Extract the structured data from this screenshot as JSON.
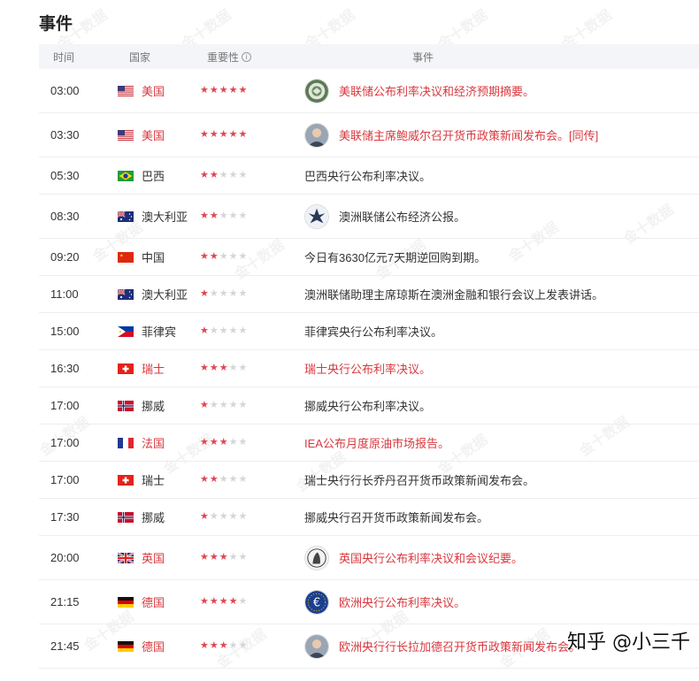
{
  "title": "事件",
  "headers": {
    "time": "时间",
    "country": "国家",
    "importance": "重要性",
    "event": "事件"
  },
  "colors": {
    "highlight": "#d9383e",
    "star_on": "#e04552",
    "star_off": "#d5d5d5"
  },
  "watermark": "金十数据",
  "credit": "知乎 @小三千",
  "events": [
    {
      "time": "03:00",
      "country": "美国",
      "flag": "us",
      "stars": 5,
      "event": "美联储公布利率决议和经济预期摘要。",
      "highlight": true,
      "avatar": "fed-seal-icon"
    },
    {
      "time": "03:30",
      "country": "美国",
      "flag": "us",
      "stars": 5,
      "event": "美联储主席鲍威尔召开货币政策新闻发布会。[同传]",
      "highlight": true,
      "avatar": "person-portrait-icon"
    },
    {
      "time": "05:30",
      "country": "巴西",
      "flag": "br",
      "stars": 2,
      "event": "巴西央行公布利率决议。",
      "highlight": false,
      "avatar": ""
    },
    {
      "time": "08:30",
      "country": "澳大利亚",
      "flag": "au",
      "stars": 2,
      "event": "澳洲联储公布经济公报。",
      "highlight": false,
      "avatar": "rba-logo-icon"
    },
    {
      "time": "09:20",
      "country": "中国",
      "flag": "cn",
      "stars": 2,
      "event": "今日有3630亿元7天期逆回购到期。",
      "highlight": false,
      "avatar": ""
    },
    {
      "time": "11:00",
      "country": "澳大利亚",
      "flag": "au",
      "stars": 1,
      "event": "澳洲联储助理主席琼斯在澳洲金融和银行会议上发表讲话。",
      "highlight": false,
      "avatar": ""
    },
    {
      "time": "15:00",
      "country": "菲律宾",
      "flag": "ph",
      "stars": 1,
      "event": "菲律宾央行公布利率决议。",
      "highlight": false,
      "avatar": ""
    },
    {
      "time": "16:30",
      "country": "瑞士",
      "flag": "ch",
      "stars": 3,
      "event": "瑞士央行公布利率决议。",
      "highlight": true,
      "avatar": ""
    },
    {
      "time": "17:00",
      "country": "挪威",
      "flag": "no",
      "stars": 1,
      "event": "挪威央行公布利率决议。",
      "highlight": false,
      "avatar": ""
    },
    {
      "time": "17:00",
      "country": "法国",
      "flag": "fr",
      "stars": 3,
      "event": "IEA公布月度原油市场报告。",
      "highlight": true,
      "avatar": ""
    },
    {
      "time": "17:00",
      "country": "瑞士",
      "flag": "ch",
      "stars": 2,
      "event": "瑞士央行行长乔丹召开货币政策新闻发布会。",
      "highlight": false,
      "avatar": ""
    },
    {
      "time": "17:30",
      "country": "挪威",
      "flag": "no",
      "stars": 1,
      "event": "挪威央行召开货币政策新闻发布会。",
      "highlight": false,
      "avatar": ""
    },
    {
      "time": "20:00",
      "country": "英国",
      "flag": "gb",
      "stars": 3,
      "event": "英国央行公布利率决议和会议纪要。",
      "highlight": true,
      "avatar": "boe-logo-icon"
    },
    {
      "time": "21:15",
      "country": "德国",
      "flag": "de",
      "stars": 4,
      "event": "欧洲央行公布利率决议。",
      "highlight": true,
      "avatar": "ecb-euro-icon"
    },
    {
      "time": "21:45",
      "country": "德国",
      "flag": "de",
      "stars": 3,
      "event": "欧洲央行行长拉加德召开货币政策新闻发布会。",
      "highlight": true,
      "avatar": "person-portrait-icon"
    }
  ]
}
